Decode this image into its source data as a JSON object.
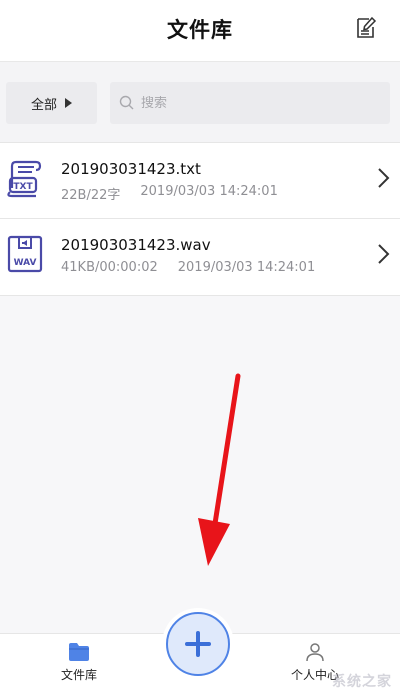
{
  "header": {
    "title": "文件库"
  },
  "filter": {
    "all_label": "全部",
    "search_placeholder": "搜索"
  },
  "files": [
    {
      "name": "201903031423.txt",
      "size": "22B/22字",
      "date": "2019/03/03 14:24:01",
      "icon": "txt-file-icon",
      "icon_text": "TXT"
    },
    {
      "name": "201903031423.wav",
      "size": "41KB/00:00:02",
      "date": "2019/03/03 14:24:01",
      "icon": "wav-file-icon",
      "icon_text": "WAV"
    }
  ],
  "bottom_nav": {
    "library_label": "文件库",
    "profile_label": "个人中心"
  },
  "watermark": "系统之家",
  "colors": {
    "accent": "#4f83e6",
    "icon_purple": "#4a4aa8",
    "annotation": "#e8141a"
  }
}
